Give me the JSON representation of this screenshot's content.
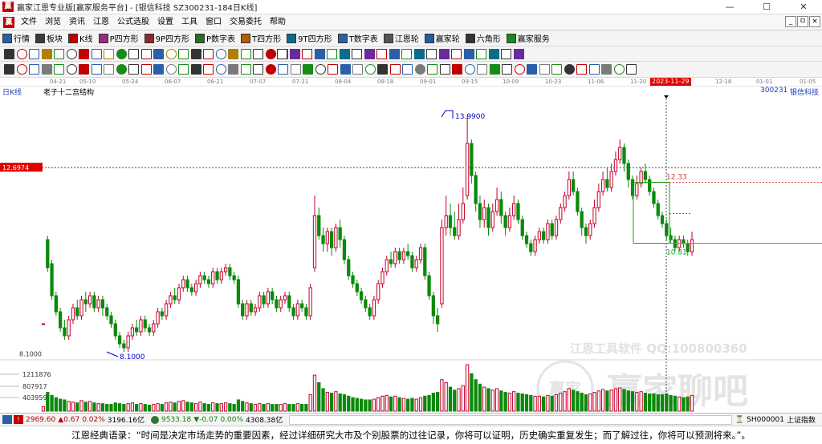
{
  "app": {
    "logo_glyph": "赢",
    "window_title": "赢家江恩专业版[赢家服务平台] - [银信科技  SZ300231-184日K线]",
    "window_buttons": [
      "—",
      "☐",
      "✕"
    ],
    "mdi_buttons": [
      "_",
      "ㅁ",
      "×"
    ]
  },
  "menu": [
    "文件",
    "浏览",
    "资讯",
    "江恩",
    "公式选股",
    "设置",
    "工具",
    "窗口",
    "交易委托",
    "帮助"
  ],
  "toolbar1": [
    {
      "label": "行情",
      "icon": "grid-icon",
      "color": "#2b5fa8"
    },
    {
      "label": "板块",
      "icon": "block-icon",
      "color": "#3a3a3a"
    },
    {
      "label": "K线",
      "icon": "candle-icon",
      "color": "#c00000"
    },
    {
      "label": "P四方形",
      "icon": "square-p-icon",
      "color": "#9a2a7d"
    },
    {
      "label": "9P四方形",
      "icon": "square-9p-icon",
      "color": "#8a2a2a"
    },
    {
      "label": "P数字表",
      "icon": "table-p-icon",
      "color": "#2a6a2a"
    },
    {
      "label": "T四方形",
      "icon": "square-t-icon",
      "color": "#b06000"
    },
    {
      "label": "9T四方形",
      "icon": "square-9t-icon",
      "color": "#0a6b8a"
    },
    {
      "label": "T数字表",
      "icon": "table-t-icon",
      "color": "#2b5fa8"
    },
    {
      "label": "江恩轮",
      "icon": "gann-wheel-icon",
      "color": "#555555"
    },
    {
      "label": "赢家轮",
      "icon": "winner-wheel-icon",
      "color": "#1f5e9e"
    },
    {
      "label": "六角形",
      "icon": "hexagon-icon",
      "color": "#333333"
    },
    {
      "label": "赢家服务",
      "icon": "dollar-icon",
      "color": "#1a8a1a"
    }
  ],
  "datebar": {
    "labels": [
      "04-21",
      "05-10",
      "05-24",
      "06-07",
      "06-21",
      "07-07",
      "07-21",
      "08-04",
      "08-18",
      "09-01",
      "09-15",
      "10-09",
      "10-23",
      "11-06",
      "11-20",
      "2023-11-29",
      "12-18",
      "01-01",
      "01-05"
    ],
    "highlight": "2023-11-29"
  },
  "chart_header": {
    "period": "日K线",
    "indicator": "老子十二宫结构",
    "code": "300231",
    "name": "银信科技"
  },
  "price_labels": {
    "crosshair_price": "12.6974",
    "low_axis": "8.1000",
    "high_marker": "13.9900",
    "low_marker": "8.1000",
    "box_top": "12.33",
    "box_bottom": "10.81"
  },
  "volume_axis": [
    "1211876",
    "807917",
    "403959"
  ],
  "watermark": {
    "brand_line": "江恩工具软件  QQ:100800360",
    "big_text": "赢家聊吧",
    "small_text": "jiaoba.yjfx.net",
    "badge": "赢家"
  },
  "statusbar": {
    "sh_value": "2969.60",
    "sh_change": "▲0.67",
    "sh_pct": "0.02%",
    "sh_amount": "3196.16亿",
    "sz_value": "9533.18",
    "sz_change": "▼-0.07",
    "sz_pct": "0.00%",
    "sz_amount": "4308.38亿",
    "index_code": "SH000001",
    "index_name": "上证指数"
  },
  "quote": "江恩经典语录：“时间是决定市场走势的重要因素，经过详细研究大市及个别股票的过往记录，你将可以证明，历史确实重复发生；而了解过往，你将可以预测将来。”。",
  "colors": {
    "up": "#c4002b",
    "down": "#0a8a0a",
    "box": "#1aa01a",
    "marker": "#0000c8",
    "crosshair_bg": "#e00000",
    "grid": "#d9d9d9"
  },
  "chart_data": {
    "type": "candlestick",
    "price_range": [
      7.8,
      14.5
    ],
    "candles": [
      [
        8.8,
        8.8,
        8.8,
        8.8,
        60000
      ],
      [
        10.9,
        10.2,
        11.0,
        10.1,
        250000
      ],
      [
        10.3,
        9.5,
        10.4,
        9.4,
        210000
      ],
      [
        9.5,
        9.1,
        9.6,
        9.0,
        180000
      ],
      [
        9.1,
        8.7,
        9.2,
        8.6,
        160000
      ],
      [
        8.7,
        8.5,
        8.9,
        8.4,
        150000
      ],
      [
        8.5,
        8.9,
        9.0,
        8.4,
        130000
      ],
      [
        8.9,
        9.2,
        9.3,
        8.8,
        120000
      ],
      [
        9.2,
        9.0,
        9.4,
        8.9,
        110000
      ],
      [
        9.0,
        9.4,
        9.5,
        8.9,
        140000
      ],
      [
        9.4,
        9.3,
        9.6,
        9.1,
        120000
      ],
      [
        9.3,
        9.5,
        9.6,
        9.2,
        130000
      ],
      [
        9.5,
        9.2,
        9.6,
        9.1,
        110000
      ],
      [
        9.2,
        9.4,
        9.5,
        9.1,
        100000
      ],
      [
        9.4,
        9.2,
        9.5,
        9.0,
        100000
      ],
      [
        9.2,
        9.0,
        9.3,
        8.9,
        90000
      ],
      [
        9.0,
        8.8,
        9.1,
        8.7,
        90000
      ],
      [
        8.8,
        8.5,
        8.9,
        8.4,
        110000
      ],
      [
        8.5,
        8.3,
        8.6,
        8.2,
        100000
      ],
      [
        8.3,
        8.2,
        8.4,
        8.1,
        90000
      ],
      [
        8.2,
        8.5,
        8.6,
        8.1,
        100000
      ],
      [
        8.5,
        8.7,
        8.8,
        8.4,
        110000
      ],
      [
        8.7,
        8.6,
        8.9,
        8.5,
        90000
      ],
      [
        8.6,
        8.9,
        9.0,
        8.5,
        100000
      ],
      [
        8.9,
        8.7,
        9.0,
        8.6,
        90000
      ],
      [
        8.7,
        8.6,
        8.8,
        8.5,
        80000
      ],
      [
        8.6,
        8.8,
        8.9,
        8.5,
        90000
      ],
      [
        8.8,
        9.1,
        9.2,
        8.7,
        100000
      ],
      [
        9.1,
        9.0,
        9.2,
        8.9,
        90000
      ],
      [
        9.0,
        9.3,
        9.4,
        8.9,
        110000
      ],
      [
        9.3,
        9.5,
        9.6,
        9.2,
        120000
      ],
      [
        9.5,
        9.4,
        9.7,
        9.3,
        110000
      ],
      [
        9.4,
        9.7,
        9.8,
        9.3,
        130000
      ],
      [
        9.7,
        9.9,
        10.0,
        9.6,
        140000
      ],
      [
        9.9,
        9.7,
        10.0,
        9.6,
        120000
      ],
      [
        9.7,
        9.6,
        9.8,
        9.5,
        110000
      ],
      [
        9.6,
        9.8,
        9.9,
        9.5,
        100000
      ],
      [
        9.8,
        10.0,
        10.1,
        9.7,
        120000
      ],
      [
        10.0,
        9.9,
        10.1,
        9.8,
        100000
      ],
      [
        9.9,
        9.8,
        10.0,
        9.7,
        90000
      ],
      [
        9.8,
        10.1,
        10.2,
        9.7,
        110000
      ],
      [
        10.1,
        9.9,
        10.2,
        9.8,
        100000
      ],
      [
        9.9,
        10.1,
        10.2,
        9.8,
        100000
      ],
      [
        10.1,
        10.2,
        10.3,
        10.0,
        110000
      ],
      [
        10.2,
        10.0,
        10.3,
        9.9,
        100000
      ],
      [
        10.0,
        9.9,
        10.1,
        9.8,
        90000
      ],
      [
        9.9,
        9.3,
        10.0,
        9.2,
        150000
      ],
      [
        9.3,
        9.0,
        9.4,
        8.9,
        130000
      ],
      [
        9.0,
        9.3,
        9.4,
        8.9,
        110000
      ],
      [
        9.3,
        9.1,
        9.4,
        9.0,
        100000
      ],
      [
        9.1,
        9.2,
        9.3,
        9.0,
        90000
      ],
      [
        9.2,
        9.5,
        9.6,
        9.1,
        100000
      ],
      [
        9.5,
        9.3,
        9.6,
        9.2,
        90000
      ],
      [
        9.3,
        9.6,
        9.7,
        9.2,
        100000
      ],
      [
        9.6,
        9.4,
        9.7,
        9.3,
        90000
      ],
      [
        9.4,
        9.2,
        9.5,
        9.1,
        90000
      ],
      [
        9.2,
        9.4,
        9.5,
        9.1,
        90000
      ],
      [
        9.4,
        9.5,
        9.6,
        9.3,
        100000
      ],
      [
        9.5,
        9.2,
        9.6,
        9.1,
        90000
      ],
      [
        9.2,
        9.0,
        9.3,
        8.9,
        90000
      ],
      [
        9.0,
        9.3,
        9.4,
        8.9,
        100000
      ],
      [
        9.3,
        9.2,
        9.4,
        9.1,
        90000
      ],
      [
        9.2,
        9.0,
        9.3,
        8.9,
        90000
      ],
      [
        9.0,
        9.7,
        9.8,
        8.9,
        220000
      ],
      [
        10.2,
        11.5,
        12.0,
        10.1,
        480000
      ],
      [
        11.5,
        11.0,
        11.7,
        10.9,
        380000
      ],
      [
        11.0,
        10.8,
        11.2,
        10.6,
        300000
      ],
      [
        10.8,
        11.1,
        11.2,
        10.6,
        250000
      ],
      [
        11.1,
        10.7,
        11.2,
        10.5,
        240000
      ],
      [
        10.7,
        11.2,
        11.3,
        10.6,
        260000
      ],
      [
        11.2,
        10.9,
        11.4,
        10.7,
        230000
      ],
      [
        10.9,
        10.4,
        11.0,
        10.3,
        220000
      ],
      [
        10.4,
        10.0,
        10.5,
        9.9,
        200000
      ],
      [
        10.0,
        9.8,
        10.1,
        9.7,
        180000
      ],
      [
        9.8,
        9.6,
        9.9,
        9.5,
        170000
      ],
      [
        9.6,
        9.4,
        9.7,
        9.3,
        160000
      ],
      [
        9.4,
        9.2,
        9.5,
        9.1,
        150000
      ],
      [
        9.2,
        9.0,
        9.3,
        8.9,
        150000
      ],
      [
        9.0,
        9.4,
        9.5,
        8.9,
        160000
      ],
      [
        9.4,
        9.8,
        9.9,
        9.3,
        180000
      ],
      [
        9.8,
        10.1,
        10.2,
        9.7,
        200000
      ],
      [
        10.1,
        10.4,
        10.5,
        10.0,
        210000
      ],
      [
        10.4,
        10.3,
        10.6,
        10.2,
        190000
      ],
      [
        10.3,
        10.6,
        10.7,
        10.2,
        200000
      ],
      [
        10.6,
        10.4,
        10.7,
        10.3,
        180000
      ],
      [
        10.4,
        10.6,
        10.7,
        10.3,
        170000
      ],
      [
        10.6,
        10.5,
        10.8,
        10.4,
        160000
      ],
      [
        10.5,
        10.2,
        10.6,
        10.1,
        170000
      ],
      [
        10.2,
        10.4,
        10.5,
        10.1,
        160000
      ],
      [
        10.4,
        10.7,
        10.8,
        10.3,
        180000
      ],
      [
        10.7,
        10.0,
        10.8,
        9.9,
        200000
      ],
      [
        10.0,
        9.5,
        10.1,
        9.4,
        210000
      ],
      [
        9.5,
        9.0,
        9.6,
        8.8,
        240000
      ],
      [
        9.0,
        8.8,
        9.2,
        8.6,
        250000
      ],
      [
        9.3,
        11.2,
        11.4,
        9.2,
        420000
      ],
      [
        11.2,
        11.5,
        12.0,
        11.0,
        380000
      ],
      [
        11.5,
        11.2,
        11.8,
        11.0,
        320000
      ],
      [
        11.2,
        11.0,
        11.6,
        10.9,
        280000
      ],
      [
        11.0,
        11.4,
        11.8,
        10.9,
        300000
      ],
      [
        11.4,
        11.8,
        12.2,
        11.3,
        340000
      ],
      [
        12.0,
        13.3,
        14.0,
        11.9,
        620000
      ],
      [
        13.3,
        12.5,
        13.4,
        12.3,
        500000
      ],
      [
        12.5,
        11.8,
        12.6,
        11.6,
        420000
      ],
      [
        11.8,
        11.4,
        12.0,
        11.2,
        360000
      ],
      [
        11.4,
        11.7,
        11.9,
        11.2,
        320000
      ],
      [
        11.7,
        11.2,
        11.8,
        11.0,
        300000
      ],
      [
        11.2,
        11.6,
        11.8,
        11.1,
        280000
      ],
      [
        11.6,
        11.9,
        12.2,
        11.5,
        300000
      ],
      [
        11.9,
        11.5,
        12.1,
        11.3,
        270000
      ],
      [
        11.5,
        11.2,
        11.6,
        11.0,
        250000
      ],
      [
        11.2,
        11.5,
        11.7,
        11.1,
        240000
      ],
      [
        11.5,
        11.8,
        12.0,
        11.4,
        260000
      ],
      [
        11.8,
        11.4,
        11.9,
        11.3,
        240000
      ],
      [
        11.4,
        11.0,
        11.5,
        10.9,
        230000
      ],
      [
        11.0,
        10.8,
        11.1,
        10.7,
        220000
      ],
      [
        10.8,
        10.6,
        10.9,
        10.5,
        210000
      ],
      [
        10.6,
        10.9,
        11.0,
        10.5,
        200000
      ],
      [
        10.9,
        11.1,
        11.2,
        10.8,
        200000
      ],
      [
        11.1,
        10.9,
        11.2,
        10.8,
        190000
      ],
      [
        10.9,
        11.3,
        11.4,
        10.8,
        210000
      ],
      [
        11.3,
        11.0,
        11.4,
        10.9,
        200000
      ],
      [
        11.0,
        11.4,
        11.5,
        10.9,
        220000
      ],
      [
        11.4,
        11.7,
        11.8,
        11.3,
        240000
      ],
      [
        11.7,
        12.0,
        12.1,
        11.6,
        260000
      ],
      [
        12.0,
        12.4,
        12.6,
        11.9,
        300000
      ],
      [
        12.4,
        12.1,
        12.6,
        12.0,
        280000
      ],
      [
        12.1,
        11.6,
        12.2,
        11.5,
        260000
      ],
      [
        11.6,
        11.2,
        11.7,
        11.0,
        240000
      ],
      [
        11.2,
        11.0,
        11.3,
        10.8,
        220000
      ],
      [
        11.0,
        11.3,
        11.4,
        10.9,
        230000
      ],
      [
        11.3,
        11.7,
        11.9,
        11.2,
        250000
      ],
      [
        11.7,
        12.1,
        12.3,
        11.6,
        270000
      ],
      [
        12.1,
        12.4,
        12.6,
        12.0,
        290000
      ],
      [
        12.4,
        12.2,
        12.7,
        12.1,
        270000
      ],
      [
        12.2,
        12.6,
        12.8,
        12.1,
        280000
      ],
      [
        12.6,
        12.9,
        13.1,
        12.5,
        300000
      ],
      [
        12.9,
        13.2,
        13.4,
        12.8,
        310000
      ],
      [
        13.2,
        12.8,
        13.3,
        12.6,
        290000
      ],
      [
        12.8,
        12.4,
        12.9,
        12.2,
        270000
      ],
      [
        12.4,
        12.0,
        12.5,
        11.9,
        260000
      ],
      [
        12.0,
        12.3,
        12.5,
        11.9,
        250000
      ],
      [
        12.3,
        12.6,
        12.7,
        12.2,
        260000
      ],
      [
        12.6,
        12.4,
        12.8,
        12.3,
        240000
      ],
      [
        12.4,
        12.1,
        12.5,
        12.0,
        230000
      ],
      [
        12.1,
        11.8,
        12.2,
        11.7,
        230000
      ],
      [
        11.8,
        11.5,
        11.9,
        11.4,
        220000
      ],
      [
        11.5,
        11.3,
        11.6,
        11.2,
        220000
      ],
      [
        11.3,
        11.0,
        11.4,
        10.9,
        230000
      ],
      [
        11.0,
        10.9,
        11.2,
        10.8,
        210000
      ],
      [
        10.9,
        10.7,
        11.0,
        10.6,
        200000
      ],
      [
        10.7,
        10.9,
        11.0,
        10.6,
        190000
      ],
      [
        10.9,
        10.8,
        11.0,
        10.7,
        180000
      ],
      [
        10.8,
        10.6,
        10.9,
        10.5,
        190000
      ],
      [
        10.6,
        10.9,
        11.1,
        10.5,
        210000
      ]
    ]
  }
}
